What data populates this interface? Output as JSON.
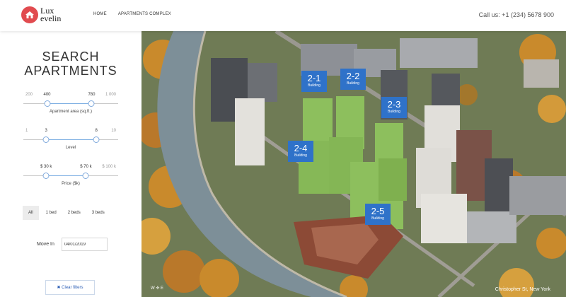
{
  "header": {
    "logo_text_top": "Lux",
    "logo_text_bottom": "evelin",
    "nav": [
      "HOME",
      "APARTMENTS COMPLEX"
    ],
    "phone": "Call us: +1 (234) 5678 900"
  },
  "sidebar": {
    "title_line1": "SEARCH",
    "title_line2": "APARTMENTS",
    "area": {
      "min": "200",
      "max": "1 000",
      "from": "400",
      "to": "780",
      "label": "Apartment area (sq.ft.)",
      "from_frac": 0.25,
      "to_frac": 0.72
    },
    "level": {
      "min": "1",
      "max": "10",
      "from": "3",
      "to": "8",
      "label": "Level",
      "from_frac": 0.24,
      "to_frac": 0.77
    },
    "price": {
      "min": "$ 30 k",
      "max": "$ 100 k",
      "from": "$ 30 k",
      "to": "$ 70 k",
      "label": "Price ($k)",
      "from_frac": 0.24,
      "to_frac": 0.66
    },
    "beds": [
      "All",
      "1 bed",
      "2 beds",
      "3 beds"
    ],
    "move_in_label": "Move In",
    "move_in_value": "04/01/2019",
    "clear_label": "✖ Clear filters"
  },
  "map": {
    "markers": [
      {
        "number": "2-1",
        "sub": "Building"
      },
      {
        "number": "2-2",
        "sub": "Building"
      },
      {
        "number": "2-3",
        "sub": "Building"
      },
      {
        "number": "2-4",
        "sub": "Building"
      },
      {
        "number": "2-5",
        "sub": "Building"
      }
    ],
    "compass": "W ✣ E",
    "location": "Christopher St, New York"
  },
  "colors": {
    "accent": "#2f72c9",
    "logo": "#e14b4f",
    "highlight_building": "#8dbf5d"
  }
}
